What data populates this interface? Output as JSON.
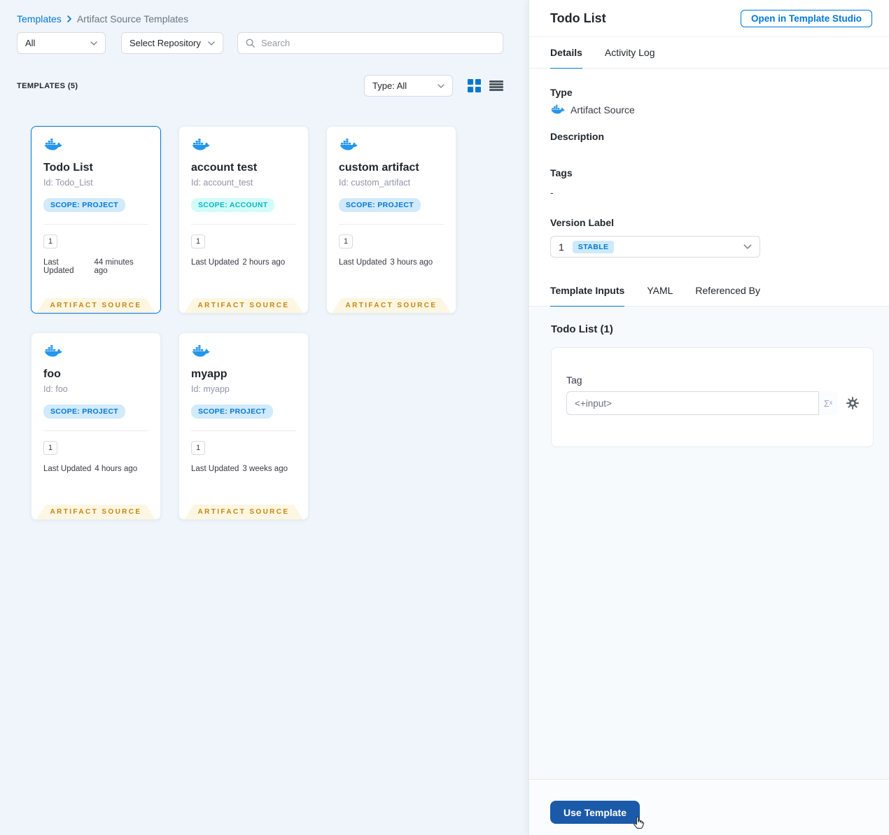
{
  "colors": {
    "accent_blue": "#0278d5",
    "docker_blue": "#2496ed",
    "scope_project_bg": "#d1eafc",
    "scope_project_text": "#0278d5",
    "scope_account_bg": "#d3fcf8",
    "scope_account_text": "#06b7c4",
    "ribbon_bg": "#fdf6e2",
    "ribbon_text": "#ca850c",
    "stable_badge_bg": "#cdeafa",
    "use_template_bg": "#1b5aa9",
    "left_background": "#eff5fa",
    "inputs_background": "#f7fafd"
  },
  "strings": {
    "last_updated": "Last Updated",
    "artifact_source": "ARTIFACT SOURCE"
  },
  "breadcrumb": {
    "templates_link": "Templates",
    "current": "Artifact Source Templates"
  },
  "filters": {
    "scope": "All",
    "repository": "Select Repository",
    "search_placeholder": "Search"
  },
  "list_header": {
    "count": "TEMPLATES (5)",
    "type_filter": "Type: All"
  },
  "cards": [
    {
      "title": "Todo List",
      "id": "Id: Todo_List",
      "scope": "SCOPE: PROJECT",
      "scope_kind": "project",
      "version": "1",
      "updated": "44 minutes ago",
      "selected": true
    },
    {
      "title": "account test",
      "id": "Id: account_test",
      "scope": "SCOPE: ACCOUNT",
      "scope_kind": "account",
      "version": "1",
      "updated": "2 hours ago",
      "selected": false
    },
    {
      "title": "custom artifact",
      "id": "Id: custom_artifact",
      "scope": "SCOPE: PROJECT",
      "scope_kind": "project",
      "version": "1",
      "updated": "3 hours ago",
      "selected": false
    },
    {
      "title": "foo",
      "id": "Id: foo",
      "scope": "SCOPE: PROJECT",
      "scope_kind": "project",
      "version": "1",
      "updated": "4 hours ago",
      "selected": false
    },
    {
      "title": "myapp",
      "id": "Id: myapp",
      "scope": "SCOPE: PROJECT",
      "scope_kind": "project",
      "version": "1",
      "updated": "3 weeks ago",
      "selected": false
    }
  ],
  "panel": {
    "title": "Todo List",
    "open_in_studio": "Open in Template Studio",
    "tabs": {
      "details": "Details",
      "activity_log": "Activity Log"
    },
    "details": {
      "type_label": "Type",
      "type_value": "Artifact Source",
      "description_label": "Description",
      "tags_label": "Tags",
      "tags_value": "-",
      "version_label": "Version Label",
      "version_value": "1",
      "version_badge": "STABLE"
    },
    "sub_tabs": {
      "template_inputs": "Template Inputs",
      "yaml": "YAML",
      "referenced_by": "Referenced By"
    },
    "inputs": {
      "heading": "Todo List (1)",
      "tag_label": "Tag",
      "tag_value": "<+input>",
      "expression_symbol": "Σˣ"
    },
    "footer": {
      "use_template": "Use Template"
    }
  }
}
